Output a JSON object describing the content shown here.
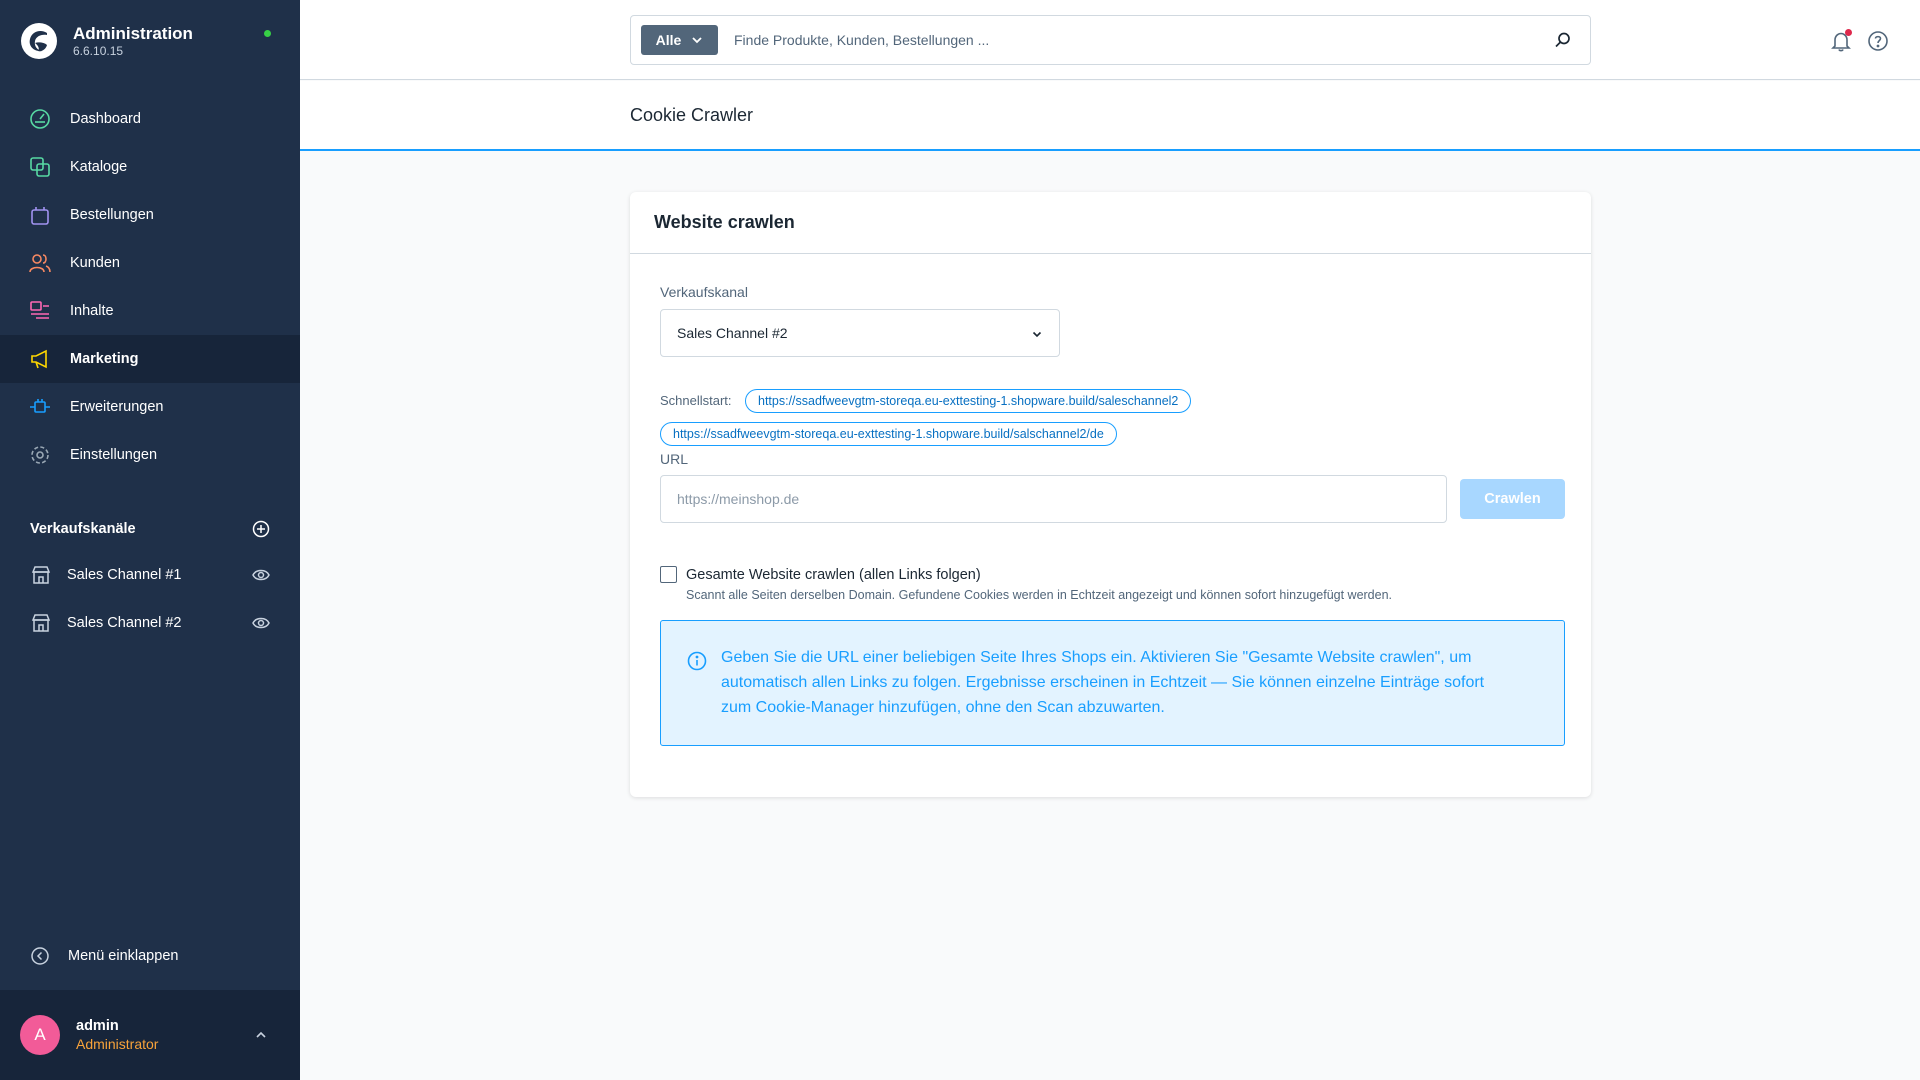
{
  "app": {
    "title": "Administration",
    "version": "6.6.10.15",
    "status_color": "#37d046"
  },
  "sidebar": {
    "items": [
      {
        "label": "Dashboard",
        "icon": "dashboard-icon",
        "color": "#57d9a3"
      },
      {
        "label": "Kataloge",
        "icon": "catalog-icon",
        "color": "#57d9a3"
      },
      {
        "label": "Bestellungen",
        "icon": "bag-icon",
        "color": "#a092f0"
      },
      {
        "label": "Kunden",
        "icon": "users-icon",
        "color": "#f88962"
      },
      {
        "label": "Inhalte",
        "icon": "content-icon",
        "color": "#ff68b4"
      },
      {
        "label": "Marketing",
        "icon": "megaphone-icon",
        "color": "#ffd700"
      },
      {
        "label": "Erweiterungen",
        "icon": "plug-icon",
        "color": "#189eff"
      },
      {
        "label": "Einstellungen",
        "icon": "gear-icon",
        "color": "#9aa8b5"
      }
    ],
    "active_index": 5,
    "channels_heading": "Verkaufskanäle",
    "channels": [
      {
        "label": "Sales Channel #1"
      },
      {
        "label": "Sales Channel #2"
      }
    ],
    "collapse_label": "Menü einklappen"
  },
  "user": {
    "initial": "A",
    "name": "admin",
    "role": "Administrator"
  },
  "search": {
    "type_label": "Alle",
    "placeholder": "Finde Produkte, Kunden, Bestellungen ..."
  },
  "page": {
    "title": "Cookie Crawler"
  },
  "card": {
    "title": "Website crawlen",
    "sales_channel_label": "Verkaufskanal",
    "sales_channel_value": "Sales Channel #2",
    "quickstart_label": "Schnellstart:",
    "quickstart_links": [
      "https://ssadfweevgtm-storeqa.eu-exttesting-1.shopware.build/saleschannel2",
      "https://ssadfweevgtm-storeqa.eu-exttesting-1.shopware.build/salschannel2/de"
    ],
    "url_label": "URL",
    "url_placeholder": "https://meinshop.de",
    "crawl_button": "Crawlen",
    "checkbox_label": "Gesamte Website crawlen (allen Links folgen)",
    "checkbox_checked": false,
    "checkbox_help": "Scannt alle Seiten derselben Domain. Gefundene Cookies werden in Echtzeit angezeigt und können sofort hinzugefügt werden.",
    "info_text": "Geben Sie die URL einer beliebigen Seite Ihres Shops ein. Aktivieren Sie \"Gesamte Website crawlen\", um automatisch allen Links zu folgen. Ergebnisse erscheinen in Echtzeit — Sie können einzelne Einträge sofort zum Cookie-Manager hinzufügen, ohne den Scan abzuwarten."
  }
}
